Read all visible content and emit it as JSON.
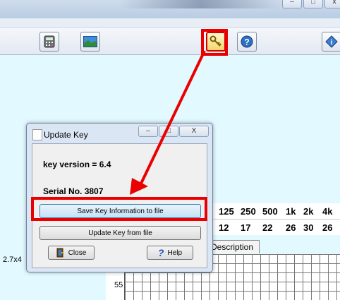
{
  "window": {
    "minimize_glyph": "–",
    "maximize_glyph": "□",
    "close_glyph": "x"
  },
  "toolbar": {
    "buttons": [
      {
        "name": "calculator",
        "active": false
      },
      {
        "name": "image",
        "active": false
      },
      {
        "name": "key",
        "active": true
      },
      {
        "name": "help",
        "active": false
      },
      {
        "name": "info",
        "active": false
      }
    ],
    "help_glyph": "?",
    "info_glyph": "i"
  },
  "table": {
    "frequencies": [
      "125",
      "250",
      "500",
      "1k",
      "2k",
      "4k"
    ],
    "values": [
      "12",
      "17",
      "22",
      "26",
      "30",
      "26"
    ],
    "tab_label": "Description"
  },
  "chart_area": {
    "dimension_label": "2.7x4",
    "y_tick": "55"
  },
  "dialog": {
    "title": "Update Key",
    "minimize_glyph": "–",
    "maximize_glyph": "□",
    "close_glyph": "X",
    "key_version": "key version = 6.4",
    "serial": "Serial No. 3807",
    "save_button": "Save Key Information to file",
    "update_button": "Update Key from file",
    "close_button": "Close",
    "help_button": "Help",
    "help_glyph": "?"
  },
  "colors": {
    "highlight": "#ea0000",
    "background": "#e2faff"
  }
}
